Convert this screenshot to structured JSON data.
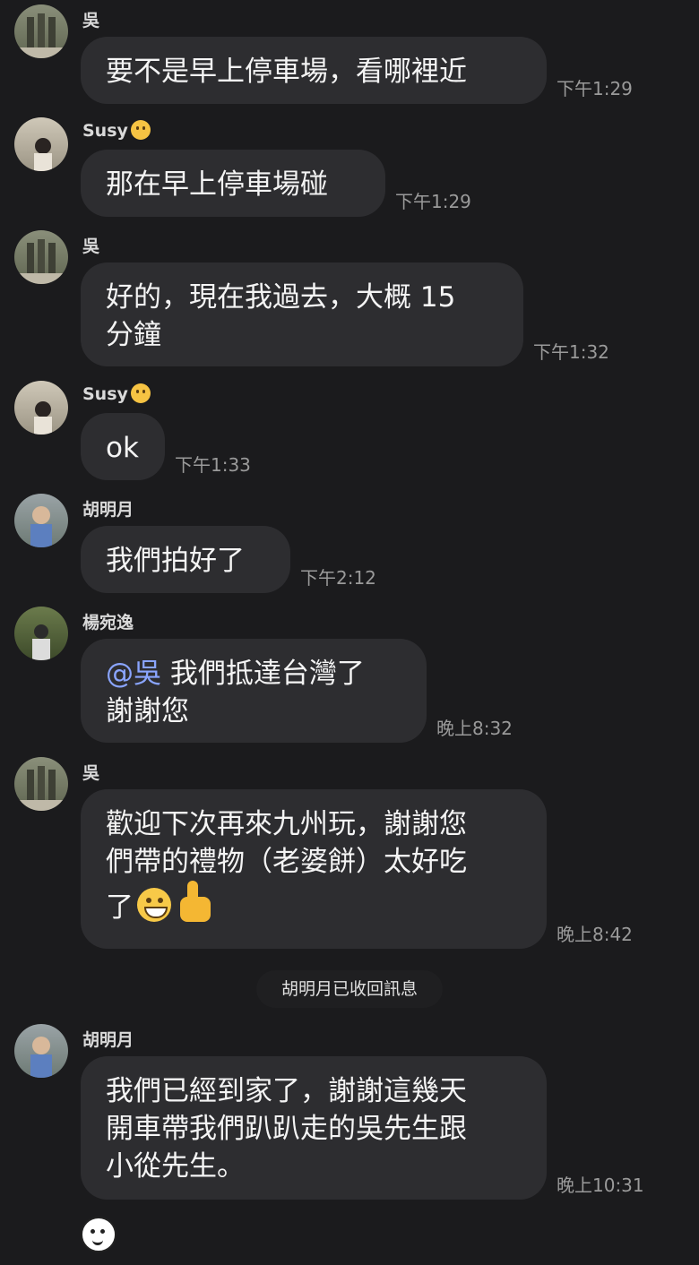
{
  "messages": [
    {
      "sender": "吳",
      "text": "要不是早上停車場，看哪裡近",
      "time": "下午1:29"
    },
    {
      "sender": "Susy",
      "text": "那在早上停車場碰",
      "time": "下午1:29"
    },
    {
      "sender": "吳",
      "text_line1": "好的，現在我過去，大概 15",
      "text_line2": "分鐘",
      "time": "下午1:32"
    },
    {
      "sender": "Susy",
      "text": "ok",
      "time": "下午1:33"
    },
    {
      "sender": "胡明月",
      "text": "我們拍好了",
      "time": "下午2:12"
    },
    {
      "sender": "楊宛逸",
      "mention": "@吳",
      "text_line1": " 我們抵達台灣了",
      "text_line2": "謝謝您",
      "time": "晚上8:32"
    },
    {
      "sender": "吳",
      "text_line1": "歡迎下次再來九州玩，謝謝您",
      "text_line2": "們帶的禮物（老婆餅）太好吃",
      "text_line3": "了",
      "time": "晚上8:42"
    },
    {
      "sender": "胡明月",
      "text_line1": "我們已經到家了，謝謝這幾天",
      "text_line2": "開車帶我們趴趴走的吳先生跟",
      "text_line3": "小從先生。",
      "time": "晚上10:31"
    }
  ],
  "notice": "胡明月已收回訊息",
  "avatars": {
    "wu": "statue-photo",
    "susy": "woman-photo",
    "hu": "person-photo",
    "yang": "person-photo"
  }
}
